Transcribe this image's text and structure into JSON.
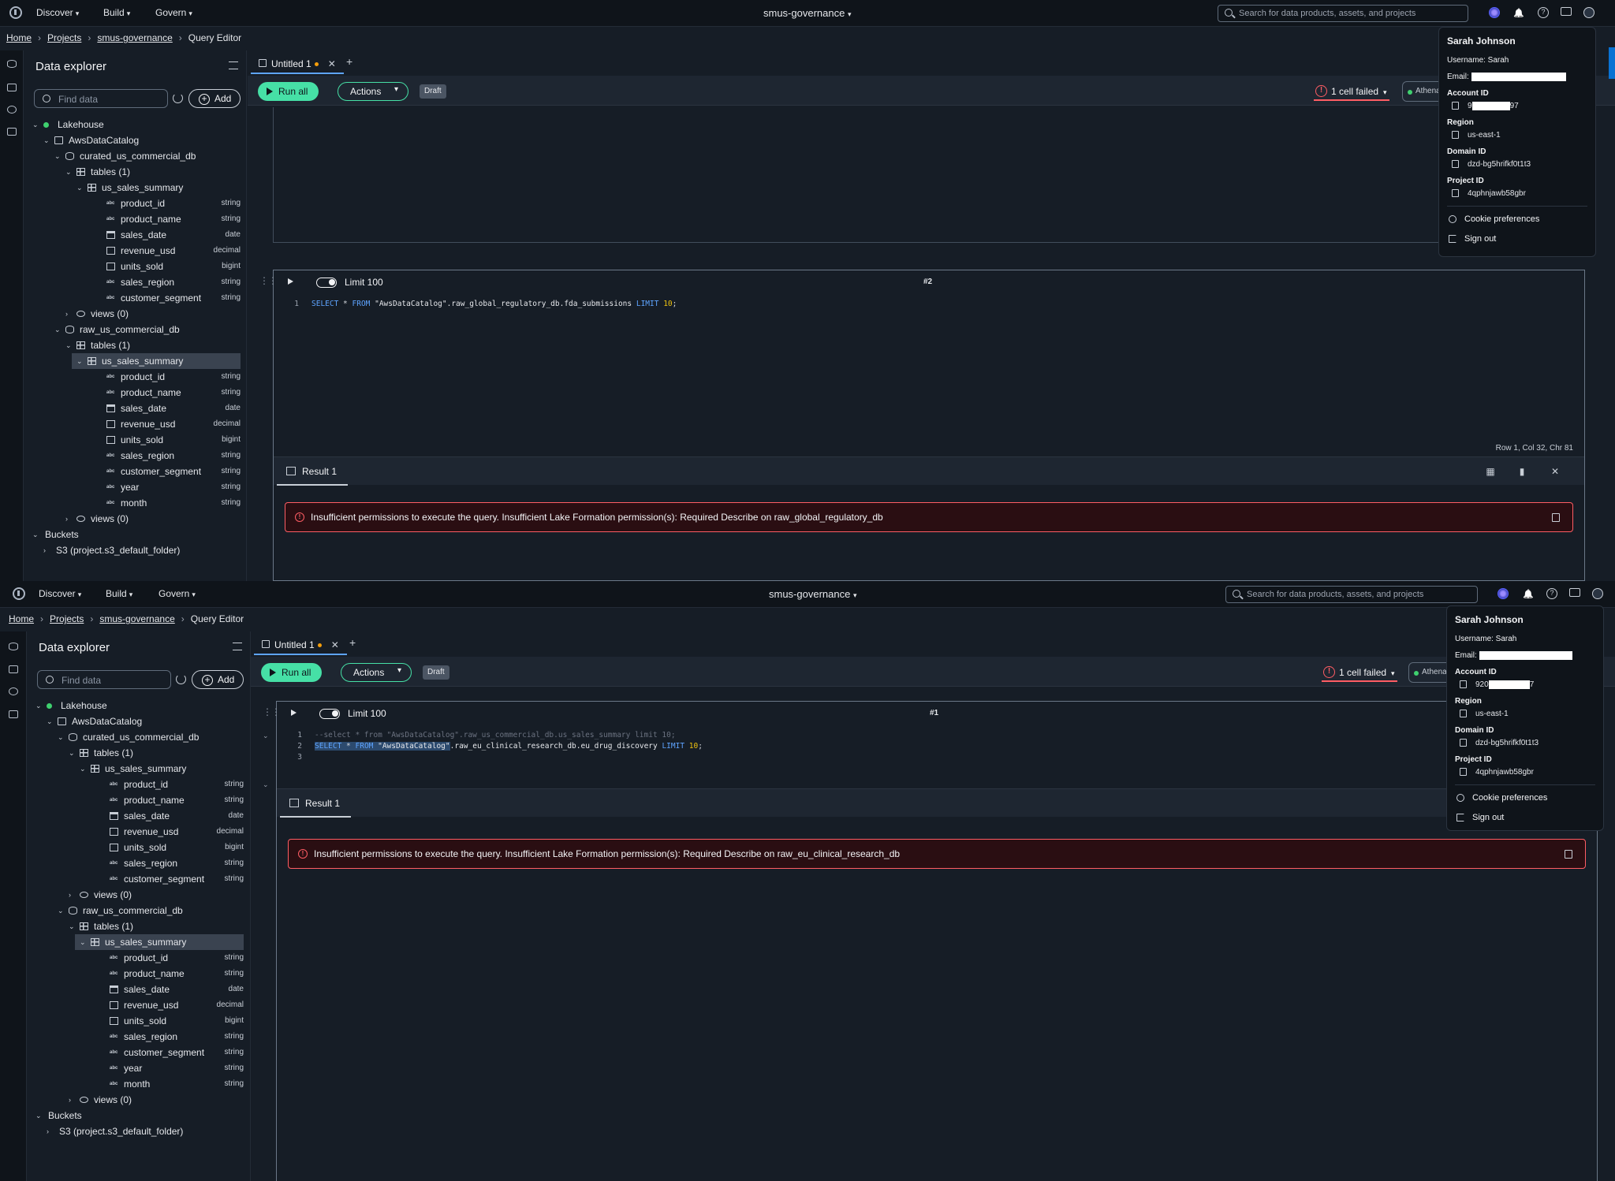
{
  "nav": {
    "menus": [
      "Discover",
      "Build",
      "Govern"
    ],
    "project_switcher": "smus-governance",
    "search_placeholder": "Search for data products, assets, and projects"
  },
  "breadcrumb": [
    "Home",
    "Projects",
    "smus-governance",
    "Query Editor"
  ],
  "explorer": {
    "title": "Data explorer",
    "find_placeholder": "Find data",
    "add_label": "Add",
    "tree": {
      "lakehouse": "Lakehouse",
      "catalog": "AwsDataCatalog",
      "db1": "curated_us_commercial_db",
      "db1_tables": "tables (1)",
      "db1_table": "us_sales_summary",
      "db1_columns": [
        {
          "name": "product_id",
          "type": "string"
        },
        {
          "name": "product_name",
          "type": "string"
        },
        {
          "name": "sales_date",
          "type": "date"
        },
        {
          "name": "revenue_usd",
          "type": "decimal"
        },
        {
          "name": "units_sold",
          "type": "bigint"
        },
        {
          "name": "sales_region",
          "type": "string"
        },
        {
          "name": "customer_segment",
          "type": "string"
        }
      ],
      "db1_views": "views (0)",
      "db2": "raw_us_commercial_db",
      "db2_tables": "tables (1)",
      "db2_table": "us_sales_summary",
      "db2_columns": [
        {
          "name": "product_id",
          "type": "string"
        },
        {
          "name": "product_name",
          "type": "string"
        },
        {
          "name": "sales_date",
          "type": "date"
        },
        {
          "name": "revenue_usd",
          "type": "decimal"
        },
        {
          "name": "units_sold",
          "type": "bigint"
        },
        {
          "name": "sales_region",
          "type": "string"
        },
        {
          "name": "customer_segment",
          "type": "string"
        },
        {
          "name": "year",
          "type": "string"
        },
        {
          "name": "month",
          "type": "string"
        }
      ],
      "db2_views": "views (0)",
      "buckets": "Buckets",
      "bucket_item": "S3 (project.s3_default_folder)"
    }
  },
  "editor": {
    "tab_label": "Untitled 1",
    "new_tab": "+",
    "run_all": "Run all",
    "actions": "Actions",
    "draft": "Draft",
    "failed": "1 cell failed",
    "engine": "Athena",
    "limit_label": "Limit 100",
    "result_tab": "Result 1"
  },
  "screen_a": {
    "cell_number": "#2",
    "code": {
      "ln": "1",
      "kw1": "SELECT",
      "star": " * ",
      "kw2": "FROM",
      "rest": " \"AwsDataCatalog\".raw_global_regulatory_db.fda_submissions ",
      "kw3": "LIMIT",
      "num": "10",
      "end": ";"
    },
    "status": "Row 1,  Col 32,  Chr 81",
    "error": "Insufficient permissions to execute the query. Insufficient Lake Formation permission(s): Required Describe on raw_global_regulatory_db"
  },
  "screen_b": {
    "cell_number": "#1",
    "code_line1": "--select * from \"AwsDataCatalog\".raw_us_commercial_db.us_sales_summary limit 10;",
    "code_line2": {
      "kw1": "SELECT",
      "star": " * ",
      "kw2": "FROM",
      "catalog": " \"AwsDataCatalog\"",
      "rest": ".raw_eu_clinical_research_db.eu_drug_discovery ",
      "kw3": "LIMIT",
      "num": "10",
      "end": ";"
    },
    "line_numbers": [
      "1",
      "2",
      "3"
    ],
    "error": "Insufficient permissions to execute the query. Insufficient Lake Formation permission(s): Required Describe on raw_eu_clinical_research_db"
  },
  "profile": {
    "name": "Sarah Johnson",
    "username": "Username: Sarah",
    "email_label": "Email: ",
    "account_label": "Account ID",
    "account_a_prefix": "9",
    "account_a_suffix": "97",
    "account_b_prefix": "920",
    "account_b_suffix": "7",
    "region_label": "Region",
    "region": "us-east-1",
    "domain_label": "Domain ID",
    "domain": "dzd-bg5hrifkf0t1t3",
    "project_label": "Project ID",
    "project": "4qphnjawb58gbr",
    "cookie": "Cookie preferences",
    "signout": "Sign out"
  },
  "colors": {
    "accent_green": "#46e0a6",
    "error_red": "#ff5d64",
    "link_blue": "#5ea4ff"
  }
}
